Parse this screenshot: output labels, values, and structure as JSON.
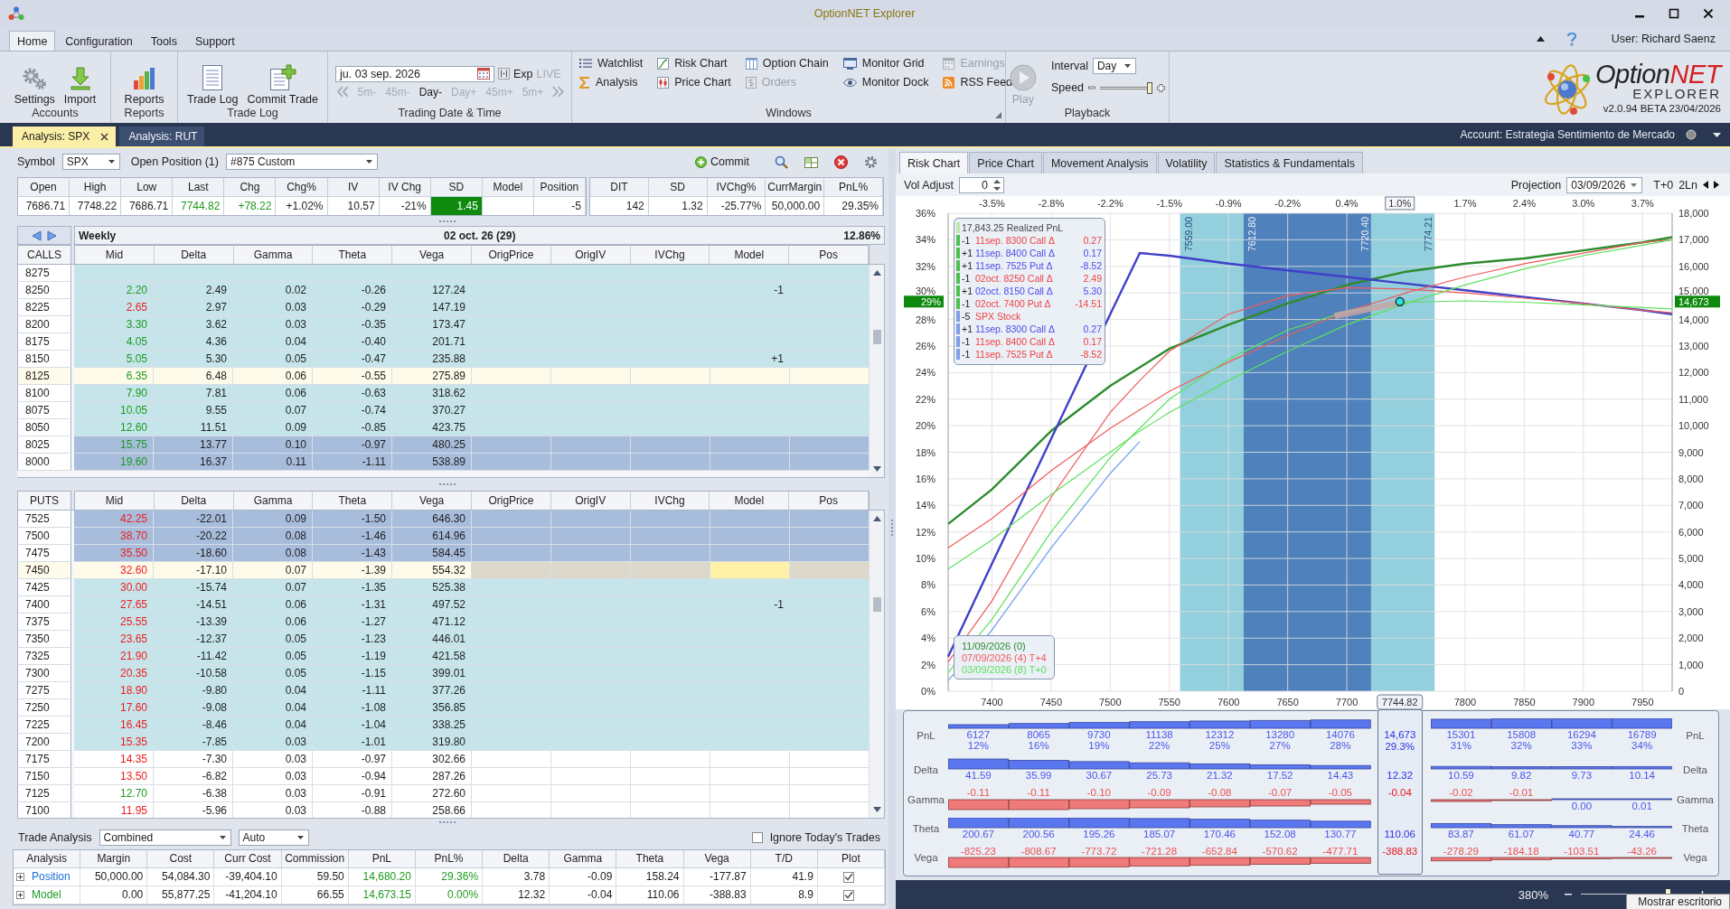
{
  "window": {
    "title": "OptionNET Explorer",
    "user": "User: Richard Saenz"
  },
  "menu_tabs": [
    {
      "label": "Home",
      "selected": true
    },
    {
      "label": "Configuration",
      "selected": false
    },
    {
      "label": "Tools",
      "selected": false
    },
    {
      "label": "Support",
      "selected": false
    }
  ],
  "ribbon": {
    "accounts": {
      "label": "Accounts",
      "buttons": [
        "Settings",
        "Import"
      ]
    },
    "reports": {
      "label": "Reports",
      "buttons": [
        "Reports"
      ]
    },
    "trade_log": {
      "label": "Trade Log",
      "buttons": [
        "Trade Log",
        "Commit Trade"
      ]
    },
    "trading_date": {
      "label": "Trading Date & Time",
      "date": "ju. 03 sep. 2026",
      "exp": "Exp",
      "live": {
        "label": "LIVE",
        "on": false
      },
      "steps": [
        {
          "label": "5m-",
          "disabled": true
        },
        {
          "label": "45m-",
          "disabled": true
        },
        {
          "label": "Day-",
          "disabled": false
        },
        {
          "label": "Day+",
          "disabled": true
        },
        {
          "label": "45m+",
          "disabled": true
        },
        {
          "label": "5m+",
          "disabled": true
        }
      ]
    },
    "windows": {
      "label": "Windows",
      "items": [
        {
          "label": "Watchlist",
          "disabled": false
        },
        {
          "label": "Analysis",
          "disabled": false
        },
        {
          "label": "Risk Chart",
          "disabled": false
        },
        {
          "label": "Price Chart",
          "disabled": false
        },
        {
          "label": "Option Chain",
          "disabled": false
        },
        {
          "label": "Orders",
          "disabled": true
        },
        {
          "label": "Monitor Grid",
          "disabled": false
        },
        {
          "label": "Monitor Dock",
          "disabled": false
        },
        {
          "label": "Earnings",
          "disabled": true
        },
        {
          "label": "RSS Feed",
          "disabled": false
        }
      ]
    },
    "playback": {
      "label": "Playback",
      "play": {
        "label": "Play",
        "disabled": true
      },
      "interval_label": "Interval",
      "interval": "Day",
      "speed_label": "Speed",
      "speed": {
        "level": 1
      }
    }
  },
  "logo": {
    "brand": "Option",
    "accent": "NET",
    "subtitle": "EXPLORER",
    "version": "v2.0.94 BETA 23/04/2026"
  },
  "doc_tabs": [
    {
      "label": "Analysis: SPX",
      "selected": true
    },
    {
      "label": "Analysis: RUT",
      "selected": false
    }
  ],
  "account": "Account: Estrategia Sentimiento de Mercado",
  "toolbar": {
    "symbol_label": "Symbol",
    "symbol": "SPX",
    "position_label": "Open Position (1)",
    "position": "#875 Custom",
    "commit": "Commit"
  },
  "quote": {
    "columns": [
      {
        "header": "Open",
        "value": "7686.71",
        "up": false,
        "highlighted": false
      },
      {
        "header": "High",
        "value": "7748.22",
        "up": false,
        "highlighted": false
      },
      {
        "header": "Low",
        "value": "7686.71",
        "up": false,
        "highlighted": false
      },
      {
        "header": "Last",
        "value": "7744.82",
        "up": true,
        "highlighted": false
      },
      {
        "header": "Chg",
        "value": "+78.22",
        "up": true,
        "highlighted": false
      },
      {
        "header": "Chg%",
        "value": "+1.02%",
        "up": false,
        "highlighted": false
      },
      {
        "header": "IV",
        "value": "10.57",
        "up": false,
        "highlighted": false
      },
      {
        "header": "IV Chg",
        "value": "-21%",
        "up": false,
        "highlighted": false
      },
      {
        "header": "SD",
        "value": "1.45",
        "up": false,
        "highlighted": true
      },
      {
        "header": "Model",
        "highlighted": false
      },
      {
        "header": "Position",
        "value": "-5",
        "up": false,
        "highlighted": false
      }
    ]
  },
  "position_stats": {
    "columns": [
      "DIT",
      "SD",
      "IVChg%",
      "CurrMargin",
      "PnL%"
    ],
    "values": [
      "142",
      "1.32",
      "-25.77%",
      "50,000.00",
      "29.35%"
    ]
  },
  "calls": {
    "series": "Weekly",
    "expiry": "02 oct. 26 (29)",
    "iv": "12.86%",
    "side_label": "CALLS",
    "columns": [
      "Mid",
      "Delta",
      "Gamma",
      "Theta",
      "Vega",
      "OrigPrice",
      "OrigIV",
      "IVChg",
      "Model",
      "Pos"
    ],
    "rows": [
      {
        "strike": "8275",
        "color": "#c6e5eb",
        "selected": false
      },
      {
        "strike": "8250",
        "mid": "2.20",
        "mid_gain": true,
        "delta": "2.49",
        "gamma": "0.02",
        "theta": "-0.26",
        "vega": "127.24",
        "model": "-1",
        "color": "#c6e5eb",
        "selected": false
      },
      {
        "strike": "8225",
        "mid": "2.65",
        "mid_gain": false,
        "delta": "2.97",
        "gamma": "0.03",
        "theta": "-0.29",
        "vega": "147.19",
        "color": "#c6e5eb",
        "selected": false
      },
      {
        "strike": "8200",
        "mid": "3.30",
        "mid_gain": true,
        "delta": "3.62",
        "gamma": "0.03",
        "theta": "-0.35",
        "vega": "173.47",
        "color": "#c6e5eb",
        "selected": false
      },
      {
        "strike": "8175",
        "mid": "4.05",
        "mid_gain": true,
        "delta": "4.36",
        "gamma": "0.04",
        "theta": "-0.40",
        "vega": "201.71",
        "color": "#c6e5eb",
        "selected": false
      },
      {
        "strike": "8150",
        "mid": "5.05",
        "mid_gain": true,
        "delta": "5.30",
        "gamma": "0.05",
        "theta": "-0.47",
        "vega": "235.88",
        "model": "+1",
        "color": "#c6e5eb",
        "selected": false
      },
      {
        "strike": "8125",
        "mid": "6.35",
        "mid_gain": true,
        "delta": "6.48",
        "gamma": "0.06",
        "theta": "-0.55",
        "vega": "275.89",
        "color": "#fffbea",
        "selected": true
      },
      {
        "strike": "8100",
        "mid": "7.90",
        "mid_gain": true,
        "delta": "7.81",
        "gamma": "0.06",
        "theta": "-0.63",
        "vega": "318.62",
        "color": "#c6e5eb",
        "selected": false
      },
      {
        "strike": "8075",
        "mid": "10.05",
        "mid_gain": true,
        "delta": "9.55",
        "gamma": "0.07",
        "theta": "-0.74",
        "vega": "370.27",
        "color": "#c6e5eb",
        "selected": false
      },
      {
        "strike": "8050",
        "mid": "12.60",
        "mid_gain": true,
        "delta": "11.51",
        "gamma": "0.09",
        "theta": "-0.85",
        "vega": "423.75",
        "color": "#c6e5eb",
        "selected": false
      },
      {
        "strike": "8025",
        "mid": "15.75",
        "mid_gain": true,
        "delta": "13.77",
        "gamma": "0.10",
        "theta": "-0.97",
        "vega": "480.25",
        "color": "#a8bddc",
        "selected": false
      },
      {
        "strike": "8000",
        "mid": "19.60",
        "mid_gain": true,
        "delta": "16.37",
        "gamma": "0.11",
        "theta": "-1.11",
        "vega": "538.89",
        "color": "#a8bddc",
        "selected": false
      }
    ]
  },
  "puts": {
    "side_label": "PUTS",
    "columns": [
      "Mid",
      "Delta",
      "Gamma",
      "Theta",
      "Vega",
      "OrigPrice",
      "OrigIV",
      "IVChg",
      "Model",
      "Pos"
    ],
    "rows": [
      {
        "strike": "7525",
        "mid": "42.25",
        "mid_gain": false,
        "delta": "-22.01",
        "gamma": "0.09",
        "theta": "-1.50",
        "vega": "646.30",
        "color": "#a8bddc",
        "selected": false,
        "focused": false
      },
      {
        "strike": "7500",
        "mid": "38.70",
        "mid_gain": false,
        "delta": "-20.22",
        "gamma": "0.08",
        "theta": "-1.46",
        "vega": "614.96",
        "color": "#a8bddc",
        "selected": false,
        "focused": false
      },
      {
        "strike": "7475",
        "mid": "35.50",
        "mid_gain": false,
        "delta": "-18.60",
        "gamma": "0.08",
        "theta": "-1.43",
        "vega": "584.45",
        "color": "#a8bddc",
        "selected": false,
        "focused": false
      },
      {
        "strike": "7450",
        "mid": "32.60",
        "mid_gain": false,
        "delta": "-17.10",
        "gamma": "0.07",
        "theta": "-1.39",
        "vega": "554.32",
        "color": "#fffbea",
        "selected": true,
        "focused": true
      },
      {
        "strike": "7425",
        "mid": "30.00",
        "mid_gain": false,
        "delta": "-15.74",
        "gamma": "0.07",
        "theta": "-1.35",
        "vega": "525.38",
        "color": "#c6e5eb",
        "selected": false,
        "focused": false
      },
      {
        "strike": "7400",
        "mid": "27.65",
        "mid_gain": false,
        "delta": "-14.51",
        "gamma": "0.06",
        "theta": "-1.31",
        "vega": "497.52",
        "model": "-1",
        "color": "#c6e5eb",
        "selected": false,
        "focused": false
      },
      {
        "strike": "7375",
        "mid": "25.55",
        "mid_gain": false,
        "delta": "-13.39",
        "gamma": "0.06",
        "theta": "-1.27",
        "vega": "471.12",
        "color": "#c6e5eb",
        "selected": false,
        "focused": false
      },
      {
        "strike": "7350",
        "mid": "23.65",
        "mid_gain": false,
        "delta": "-12.37",
        "gamma": "0.05",
        "theta": "-1.23",
        "vega": "446.01",
        "color": "#c6e5eb",
        "selected": false,
        "focused": false
      },
      {
        "strike": "7325",
        "mid": "21.90",
        "mid_gain": false,
        "delta": "-11.42",
        "gamma": "0.05",
        "theta": "-1.19",
        "vega": "421.58",
        "color": "#c6e5eb",
        "selected": false,
        "focused": false
      },
      {
        "strike": "7300",
        "mid": "20.35",
        "mid_gain": false,
        "delta": "-10.58",
        "gamma": "0.05",
        "theta": "-1.15",
        "vega": "399.01",
        "color": "#c6e5eb",
        "selected": false,
        "focused": false
      },
      {
        "strike": "7275",
        "mid": "18.90",
        "mid_gain": false,
        "delta": "-9.80",
        "gamma": "0.04",
        "theta": "-1.11",
        "vega": "377.26",
        "color": "#c6e5eb",
        "selected": false,
        "focused": false
      },
      {
        "strike": "7250",
        "mid": "17.60",
        "mid_gain": false,
        "delta": "-9.08",
        "gamma": "0.04",
        "theta": "-1.08",
        "vega": "356.85",
        "color": "#c6e5eb",
        "selected": false,
        "focused": false
      },
      {
        "strike": "7225",
        "mid": "16.45",
        "mid_gain": false,
        "delta": "-8.46",
        "gamma": "0.04",
        "theta": "-1.04",
        "vega": "338.25",
        "color": "#c6e5eb",
        "selected": false,
        "focused": false
      },
      {
        "strike": "7200",
        "mid": "15.35",
        "mid_gain": false,
        "delta": "-7.85",
        "gamma": "0.03",
        "theta": "-1.01",
        "vega": "319.80",
        "color": "#c6e5eb",
        "selected": false,
        "focused": false
      },
      {
        "strike": "7175",
        "mid": "14.35",
        "mid_gain": false,
        "delta": "-7.30",
        "gamma": "0.03",
        "theta": "-0.97",
        "vega": "302.66",
        "color": "#ffffff",
        "selected": false,
        "focused": false
      },
      {
        "strike": "7150",
        "mid": "13.50",
        "mid_gain": false,
        "delta": "-6.82",
        "gamma": "0.03",
        "theta": "-0.94",
        "vega": "287.26",
        "color": "#ffffff",
        "selected": false,
        "focused": false
      },
      {
        "strike": "7125",
        "mid": "12.70",
        "mid_gain": true,
        "delta": "-6.38",
        "gamma": "0.03",
        "theta": "-0.91",
        "vega": "272.60",
        "color": "#ffffff",
        "selected": false,
        "focused": false
      },
      {
        "strike": "7100",
        "mid": "11.95",
        "mid_gain": false,
        "delta": "-5.96",
        "gamma": "0.03",
        "theta": "-0.88",
        "vega": "258.66",
        "color": "#ffffff",
        "selected": false,
        "focused": false
      }
    ]
  },
  "trade_analysis": {
    "label": "Trade Analysis",
    "mode": "Combined",
    "scale": "Auto",
    "ignore_today": {
      "label": "Ignore Today's Trades",
      "checked": false
    },
    "columns": [
      "Analysis",
      "Margin",
      "Cost",
      "Curr Cost",
      "Commission",
      "PnL",
      "PnL%",
      "Delta",
      "Gamma",
      "Theta",
      "Vega",
      "T/D",
      "Plot"
    ],
    "rows": [
      {
        "name": "Position",
        "color": "#1a6fd6",
        "values": [
          {
            "text": "50,000.00",
            "gain": false
          },
          {
            "text": "54,084.30",
            "gain": false
          },
          {
            "text": "-39,404.10",
            "gain": false
          },
          {
            "text": "59.50",
            "gain": false
          },
          {
            "text": "14,680.20",
            "gain": true
          },
          {
            "text": "29.36%",
            "gain": true
          },
          {
            "text": "3.78",
            "gain": false
          },
          {
            "text": "-0.09",
            "gain": false
          },
          {
            "text": "158.24",
            "gain": false
          },
          {
            "text": "-177.87",
            "gain": false
          },
          {
            "text": "41.9",
            "gain": false
          }
        ],
        "plot": true
      },
      {
        "name": "Model",
        "color": "#1f9a2a",
        "values": [
          {
            "text": "0.00",
            "gain": false
          },
          {
            "text": "55,877.25",
            "gain": false
          },
          {
            "text": "-41,204.10",
            "gain": false
          },
          {
            "text": "66.55",
            "gain": false
          },
          {
            "text": "14,673.15",
            "gain": true
          },
          {
            "text": "0.00%",
            "gain": true
          },
          {
            "text": "12.32",
            "gain": false
          },
          {
            "text": "-0.04",
            "gain": false
          },
          {
            "text": "110.06",
            "gain": false
          },
          {
            "text": "-388.83",
            "gain": false
          },
          {
            "text": "8.9",
            "gain": false
          }
        ],
        "plot": true
      }
    ]
  },
  "chart_tabs": [
    {
      "label": "Risk Chart",
      "selected": true
    },
    {
      "label": "Price Chart",
      "selected": false
    },
    {
      "label": "Movement Analysis",
      "selected": false
    },
    {
      "label": "Volatility",
      "selected": false
    },
    {
      "label": "Statistics & Fundamentals",
      "selected": false
    }
  ],
  "risk_chart": {
    "vol_adjust_label": "Vol Adjust",
    "vol_adjust": "0",
    "projection_label": "Projection",
    "projection": "03/09/2026",
    "offset": "T+0",
    "lines": "2Ln",
    "move_ticks": [
      "-3.5%",
      "-2.8%",
      "-2.2%",
      "-1.5%",
      "-0.9%",
      "-0.2%",
      "0.4%",
      "1.7%",
      "2.4%",
      "3.0%",
      "3.7%"
    ],
    "pct_ticks": [
      "36%",
      "34%",
      "32%",
      "30%",
      "28%",
      "26%",
      "24%",
      "22%",
      "20%",
      "18%",
      "16%",
      "14%",
      "12%",
      "10%",
      "8%",
      "6%",
      "4%",
      "2%",
      "0%"
    ],
    "band_labels": [
      {
        "low": "7559.00",
        "high": "7774.21"
      },
      {
        "low": "7612.80",
        "high": "7720.40"
      }
    ],
    "current_labels": {
      "price": "7744.82",
      "pnl": "14,673",
      "pct": "29%",
      "move": "1.0%"
    },
    "legend": {
      "realized": "17,843.25 Realized PnL",
      "items": [
        {
          "qty": "-1",
          "desc": "11sep. 8300 Call Δ",
          "value": "0.27",
          "color": "#ee4040",
          "open": true
        },
        {
          "qty": "+1",
          "desc": "11sep. 8400 Call Δ",
          "value": "0.17",
          "color": "#4a4ae8",
          "open": true
        },
        {
          "qty": "+1",
          "desc": "11sep. 7525 Put Δ",
          "value": "-8.52",
          "color": "#4a4ae8",
          "open": true
        },
        {
          "qty": "-1",
          "desc": "02oct. 8250 Call Δ",
          "value": "2.49",
          "color": "#ee4040",
          "open": true
        },
        {
          "qty": "+1",
          "desc": "02oct. 8150 Call Δ",
          "value": "5.30",
          "color": "#4a4ae8",
          "open": true
        },
        {
          "qty": "-1",
          "desc": "02oct. 7400 Put Δ",
          "value": "-14.51",
          "color": "#ee4040",
          "open": true
        },
        {
          "qty": "-5",
          "desc": "SPX Stock",
          "color": "#ee4040",
          "open": false
        },
        {
          "qty": "+1",
          "desc": "11sep. 8300 Call Δ",
          "value": "0.27",
          "color": "#4a4ae8",
          "open": false
        },
        {
          "qty": "-1",
          "desc": "11sep. 8400 Call Δ",
          "value": "0.17",
          "color": "#ee4040",
          "open": false
        },
        {
          "qty": "-1",
          "desc": "11sep. 7525 Put Δ",
          "value": "-8.52",
          "color": "#ee4040",
          "open": false
        }
      ]
    },
    "chart_data": {
      "type": "line",
      "x": [
        7363,
        7400,
        7450,
        7500,
        7525,
        7550,
        7600,
        7650,
        7700,
        7750,
        7800,
        7850,
        7900,
        7950,
        7975
      ],
      "series": [
        {
          "name": "11/09/2026 (0)",
          "color": "#2e8b2e",
          "values": [
            6300,
            7600,
            9800,
            11500,
            12200,
            12900,
            13800,
            14600,
            15300,
            15800,
            16100,
            16300,
            16600,
            16900,
            17100
          ]
        },
        {
          "color": "#4040c8",
          "values": [
            1300,
            4800,
            9500,
            14200,
            16500,
            16400,
            16100,
            15850,
            15600,
            15350,
            15100,
            14850,
            14600,
            14350,
            14200
          ]
        },
        {
          "name": "07/09/2026 (4) T+4",
          "color": "#f05a5a",
          "values": [
            5400,
            6500,
            8300,
            9900,
            10600,
            11300,
            12400,
            13400,
            14300,
            15000,
            15600,
            16100,
            16500,
            16900,
            17000
          ]
        },
        {
          "color": "#f05a5a",
          "values": [
            1100,
            3400,
            7300,
            10500,
            11700,
            12800,
            14200,
            14900,
            15200,
            15150,
            15000,
            14800,
            14600,
            14350,
            14250
          ]
        },
        {
          "name": "03/09/2026 (8) T+0",
          "color": "#5ee05e",
          "values": [
            4600,
            5700,
            7400,
            9000,
            9800,
            10500,
            11700,
            12800,
            13800,
            14600,
            15300,
            15900,
            16400,
            16800,
            17000
          ]
        },
        {
          "color": "#5ee05e",
          "values": [
            700,
            2700,
            6000,
            8800,
            9900,
            11000,
            12500,
            13600,
            14300,
            14650,
            14700,
            14650,
            14550,
            14450,
            14400
          ]
        },
        {
          "color": "#6a9ef0",
          "values": [
            400,
            2300,
            5400,
            8200,
            9400,
            null,
            null,
            null,
            null,
            null,
            null,
            null,
            null,
            null,
            null
          ]
        }
      ],
      "xlim": [
        7363,
        7975
      ],
      "ylim": [
        0,
        18000
      ],
      "grid": true,
      "xticks": [
        7400,
        7450,
        7500,
        7550,
        7600,
        7650,
        7700,
        7800,
        7850,
        7900,
        7950
      ],
      "yticks": [
        {
          "value": 0,
          "label": "0"
        },
        {
          "value": 1000,
          "label": "1,000"
        },
        {
          "value": 2000,
          "label": "2,000"
        },
        {
          "value": 3000,
          "label": "3,000"
        },
        {
          "value": 4000,
          "label": "4,000"
        },
        {
          "value": 5000,
          "label": "5,000"
        },
        {
          "value": 6000,
          "label": "6,000"
        },
        {
          "value": 7000,
          "label": "7,000"
        },
        {
          "value": 8000,
          "label": "8,000"
        },
        {
          "value": 9000,
          "label": "9,000"
        },
        {
          "value": 10000,
          "label": "10,000"
        },
        {
          "value": 11000,
          "label": "11,000"
        },
        {
          "value": 12000,
          "label": "12,000"
        },
        {
          "value": 13000,
          "label": "13,000"
        },
        {
          "value": 14000,
          "label": "14,000"
        },
        {
          "value": 15000,
          "label": "15,000"
        },
        {
          "value": 16000,
          "label": "16,000"
        },
        {
          "value": 17000,
          "label": "17,000"
        },
        {
          "value": 18000,
          "label": "18,000"
        }
      ],
      "bands": [
        {
          "axis": "x",
          "from": 7559.0,
          "to": 7774.21,
          "color": "#93cfdc"
        },
        {
          "axis": "x",
          "from": 7612.8,
          "to": 7720.4,
          "color": "#4f81bd"
        }
      ]
    }
  },
  "greeks": {
    "rows": [
      {
        "label_left": "PnL",
        "label_right": "PnL",
        "current": {
          "value": "14,673",
          "pct": "29.3%"
        },
        "cells": [
          {
            "value": "6127",
            "pct": "12%"
          },
          {
            "value": "8065",
            "pct": "16%"
          },
          {
            "value": "9730",
            "pct": "19%"
          },
          {
            "value": "11138",
            "pct": "22%"
          },
          {
            "value": "12312",
            "pct": "25%"
          },
          {
            "value": "13280",
            "pct": "27%"
          },
          {
            "value": "14076",
            "pct": "28%"
          },
          {
            "value": "15301",
            "pct": "31%"
          },
          {
            "value": "15808",
            "pct": "32%"
          },
          {
            "value": "16294",
            "pct": "33%"
          },
          {
            "value": "16789",
            "pct": "34%"
          }
        ]
      },
      {
        "label_left": "Delta",
        "label_right": "Delta",
        "current": {
          "value": "12.32"
        },
        "cells": [
          {
            "value": "41.59"
          },
          {
            "value": "35.99"
          },
          {
            "value": "30.67"
          },
          {
            "value": "25.73"
          },
          {
            "value": "21.32"
          },
          {
            "value": "17.52"
          },
          {
            "value": "14.43"
          },
          {
            "value": "10.59"
          },
          {
            "value": "9.82"
          },
          {
            "value": "9.73"
          },
          {
            "value": "10.14"
          }
        ]
      },
      {
        "label_left": "Gamma",
        "label_right": "Gamma",
        "current": {
          "value": "-0.04"
        },
        "cells": [
          {
            "value": "-0.11"
          },
          {
            "value": "-0.11"
          },
          {
            "value": "-0.10"
          },
          {
            "value": "-0.09"
          },
          {
            "value": "-0.08"
          },
          {
            "value": "-0.07"
          },
          {
            "value": "-0.05"
          },
          {
            "value": "-0.02"
          },
          {
            "value": "-0.01"
          },
          {
            "value": "0.00"
          },
          {
            "value": "0.01"
          }
        ]
      },
      {
        "label_left": "Theta",
        "label_right": "Theta",
        "current": {
          "value": "110.06"
        },
        "cells": [
          {
            "value": "200.67"
          },
          {
            "value": "200.56"
          },
          {
            "value": "195.26"
          },
          {
            "value": "185.07"
          },
          {
            "value": "170.46"
          },
          {
            "value": "152.08"
          },
          {
            "value": "130.77"
          },
          {
            "value": "83.87"
          },
          {
            "value": "61.07"
          },
          {
            "value": "40.77"
          },
          {
            "value": "24.46"
          }
        ]
      },
      {
        "label_left": "Vega",
        "label_right": "Vega",
        "current": {
          "value": "-388.83"
        },
        "cells": [
          {
            "value": "-825.23"
          },
          {
            "value": "-808.67"
          },
          {
            "value": "-773.72"
          },
          {
            "value": "-721.28"
          },
          {
            "value": "-652.84"
          },
          {
            "value": "-570.62"
          },
          {
            "value": "-477.71"
          },
          {
            "value": "-278.29"
          },
          {
            "value": "-184.18"
          },
          {
            "value": "-103.51"
          },
          {
            "value": "-43.26"
          }
        ]
      }
    ]
  },
  "status": {
    "zoom": "380%",
    "zoom_slider": {
      "level": 0.8
    },
    "tooltip": "Mostrar escritorio"
  }
}
